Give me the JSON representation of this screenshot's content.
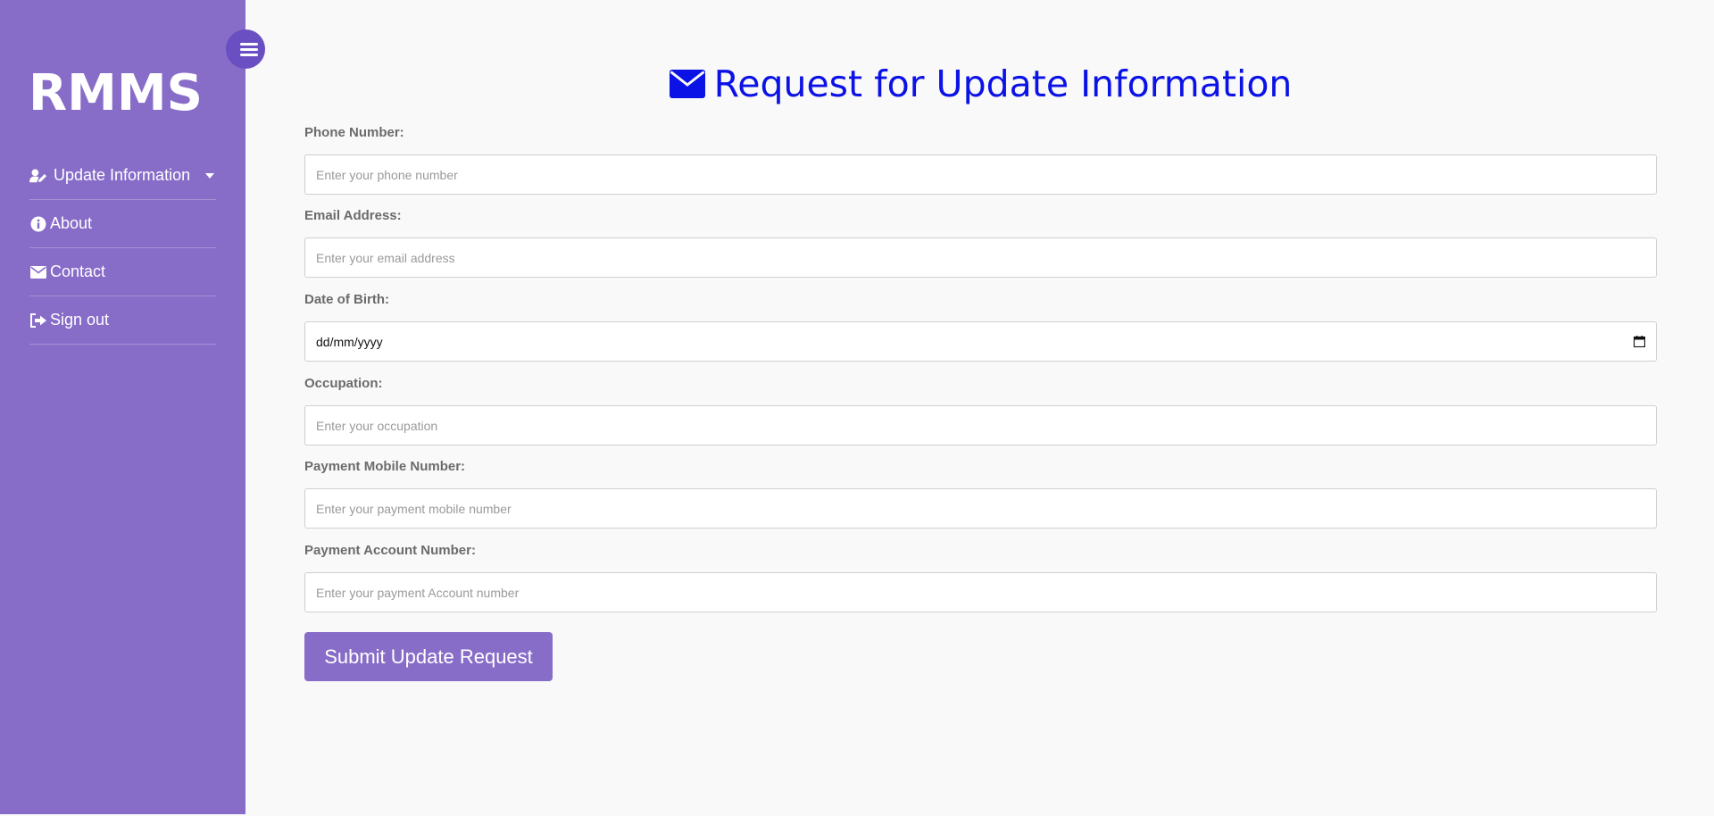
{
  "sidebar": {
    "brand": "RMMS",
    "items": [
      {
        "label": "Update Information",
        "icon": "user-edit-icon",
        "has_caret": true
      },
      {
        "label": "About",
        "icon": "info-circle-icon"
      },
      {
        "label": "Contact",
        "icon": "envelope-icon"
      },
      {
        "label": "Sign out",
        "icon": "sign-out-icon"
      }
    ],
    "toggle_icon": "menu-icon",
    "color": "#876cc8"
  },
  "main": {
    "title": "Request for Update Information",
    "title_icon": "envelope-icon",
    "title_color": "#0b12e6",
    "fields": [
      {
        "label": "Phone Number:",
        "placeholder": "Enter your phone number"
      },
      {
        "label": "Email Address:",
        "placeholder": "Enter your email address"
      },
      {
        "label": "Date of Birth:",
        "value": "dd/mm/yyyy"
      },
      {
        "label": "Occupation:",
        "placeholder": "Enter your occupation"
      },
      {
        "label": "Payment Mobile Number:",
        "placeholder": "Enter your payment mobile number"
      },
      {
        "label": "Payment Account Number:",
        "placeholder": "Enter your payment Account number"
      }
    ],
    "submit_label": "Submit Update Request"
  }
}
